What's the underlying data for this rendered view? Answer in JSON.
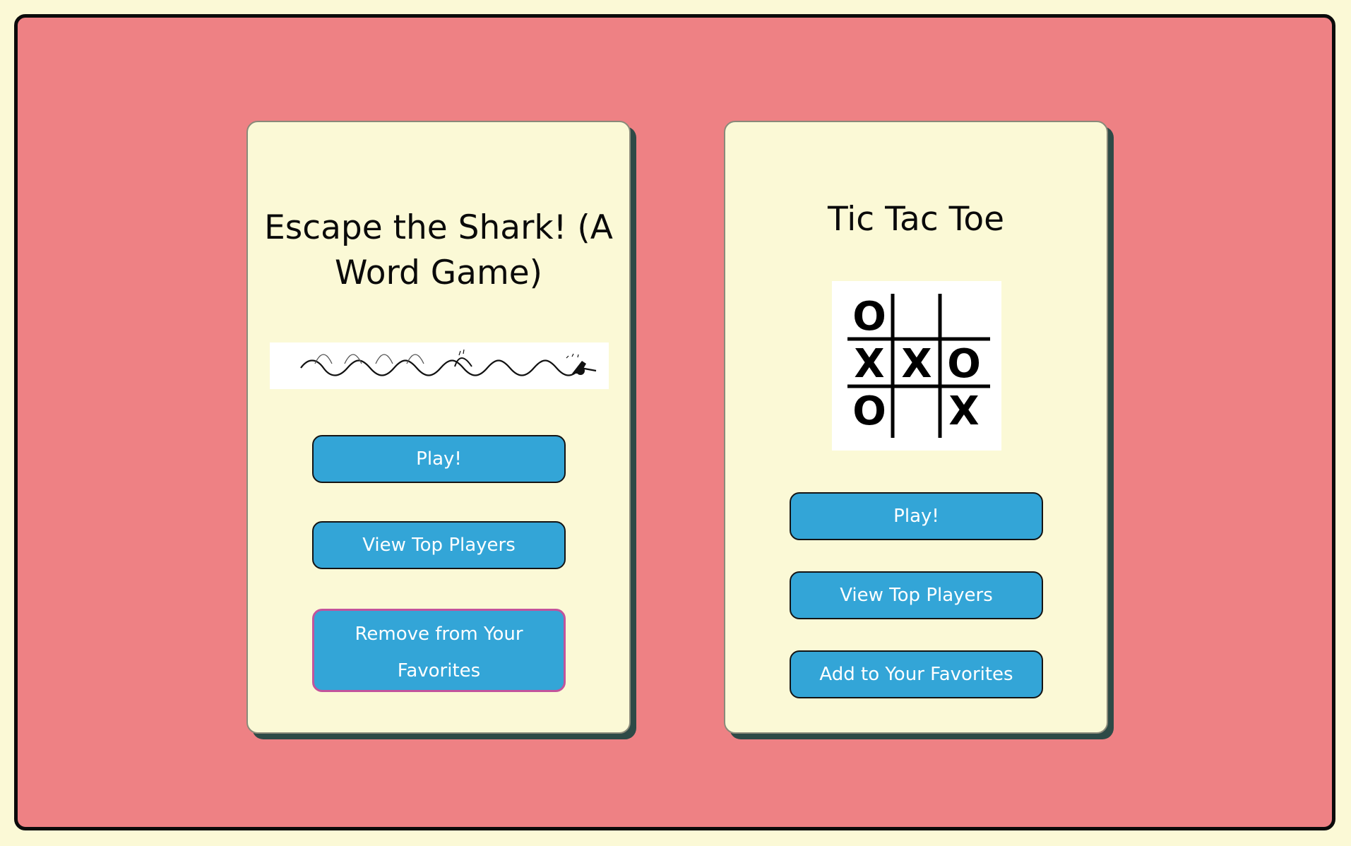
{
  "games": [
    {
      "title": "Escape the Shark! (A Word Game)",
      "image_icon": "shark-wave-swimmer-icon",
      "play_label": "Play!",
      "top_players_label": "View Top Players",
      "favorite_label": "Remove from Your Favorites"
    },
    {
      "title": "Tic Tac Toe",
      "image_icon": "tic-tac-toe-board-icon",
      "board": [
        [
          "O",
          "",
          ""
        ],
        [
          "X",
          "X",
          "O"
        ],
        [
          "O",
          "",
          "X"
        ]
      ],
      "play_label": "Play!",
      "top_players_label": "View Top Players",
      "favorite_label": "Add to Your Favorites"
    }
  ],
  "colors": {
    "page_background": "#fbf9d6",
    "panel_background": "#ee8184",
    "card_background": "#fbf9d6",
    "button": "#33a5d7",
    "focused_button_border": "#c2549c"
  }
}
